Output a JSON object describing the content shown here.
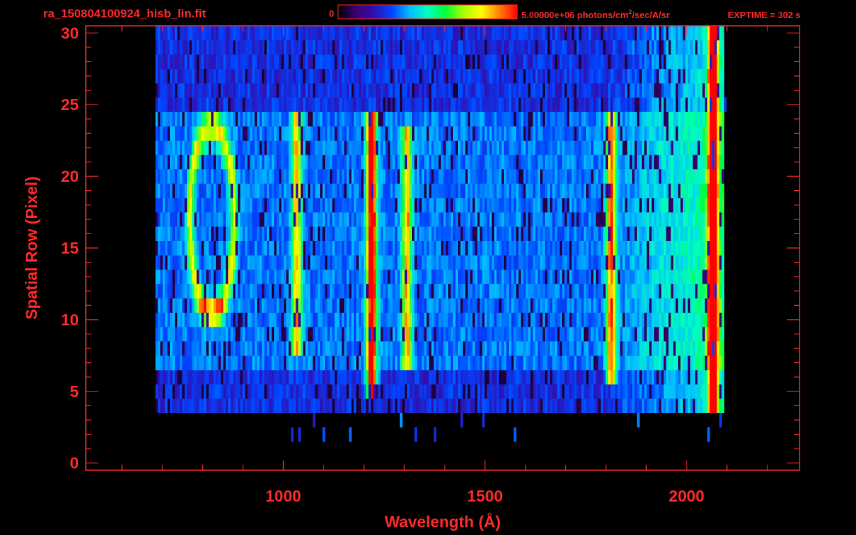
{
  "header": {
    "filename": "ra_150804100924_hisb_lin.fit",
    "colorbar_min": "0",
    "colorbar_max_value": "5.00000e+06 photons/cm",
    "colorbar_max_sup": "2",
    "colorbar_max_tail": "/sec/A/sr",
    "exptime": "EXPTIME = 302 s"
  },
  "colors": {
    "frame": "#ff2a2a",
    "colormap": [
      "#000000",
      "#3a0070",
      "#3010b0",
      "#0044ff",
      "#00bfff",
      "#00ffbf",
      "#00ff3a",
      "#aaff00",
      "#ffff00",
      "#ff8000",
      "#ff0000"
    ]
  },
  "chart_data": {
    "type": "heatmap",
    "title": "ra_150804100924_hisb_lin.fit",
    "xlabel": "Wavelength (Å)",
    "ylabel": "Spatial Row (Pixel)",
    "xlim": [
      510,
      2280
    ],
    "ylim": [
      -0.5,
      30.5
    ],
    "xticks": [
      1000,
      1500,
      2000
    ],
    "yticks": [
      0,
      5,
      10,
      15,
      20,
      25,
      30
    ],
    "colorbar": {
      "min": 0,
      "max": 5000000,
      "units": "photons/cm^2/sec/A/sr"
    },
    "grid": false,
    "detector_extent": {
      "x": [
        680,
        2065
      ],
      "y": [
        4,
        30
      ]
    },
    "features": [
      {
        "label": "O I 1304 aperture ring",
        "center_x": 820,
        "center_y": 17,
        "rx": 55,
        "ry": 6.5
      },
      {
        "label": "Lyman-alpha",
        "x": 1216,
        "y_range": [
          5,
          24
        ],
        "intensity_fraction": 0.9
      },
      {
        "label": "line",
        "x": 1030,
        "y_range": [
          8,
          24
        ],
        "intensity_fraction": 0.55
      },
      {
        "label": "line",
        "x": 1304,
        "y_range": [
          7,
          23
        ],
        "intensity_fraction": 0.55
      },
      {
        "label": "line",
        "x": 1810,
        "y_range": [
          6,
          24
        ],
        "intensity_fraction": 0.65
      },
      {
        "label": "detector edge",
        "x": 2062,
        "y_range": [
          2,
          30
        ],
        "intensity_fraction": 0.95
      }
    ]
  }
}
